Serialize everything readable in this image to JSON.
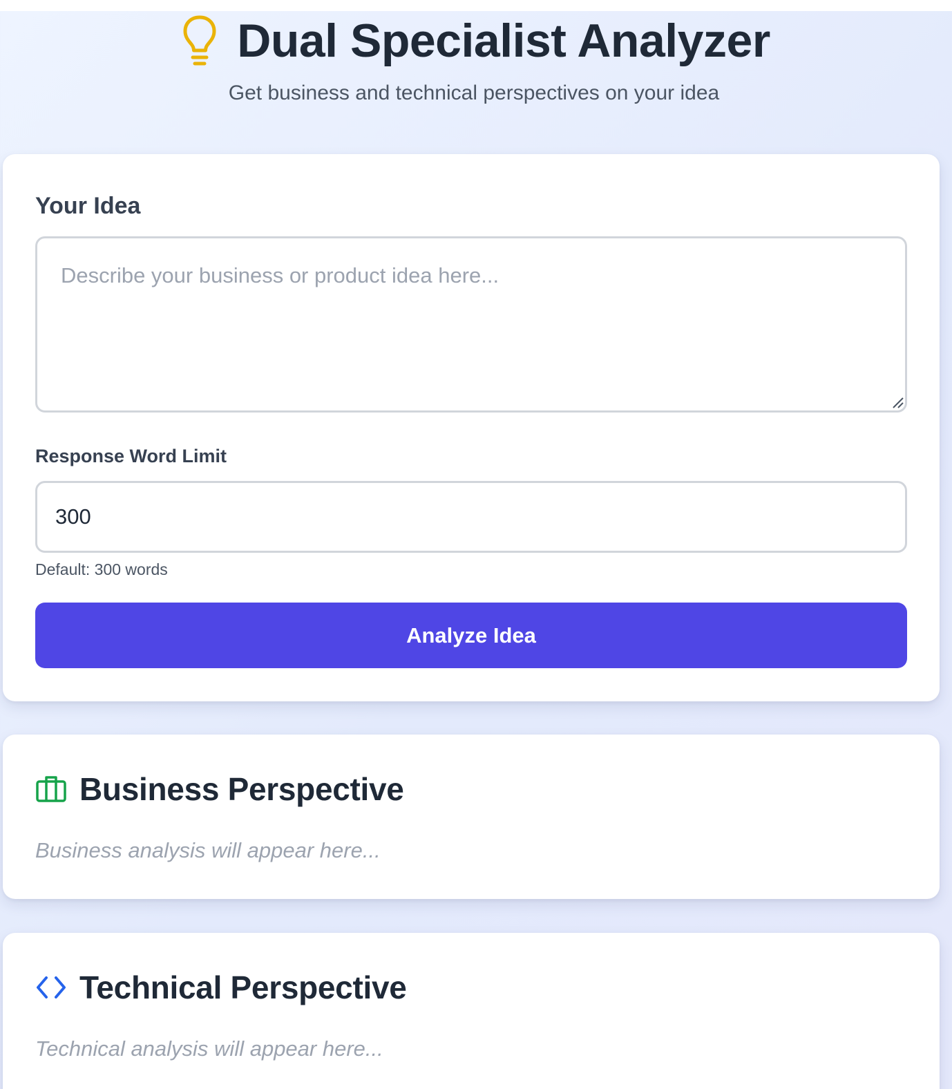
{
  "header": {
    "title": "Dual Specialist Analyzer",
    "subtitle": "Get business and technical perspectives on your idea",
    "icon": "lightbulb-icon",
    "icon_color": "#eab308"
  },
  "form": {
    "idea_label": "Your Idea",
    "idea_placeholder": "Describe your business or product idea here...",
    "idea_value": "",
    "limit_label": "Response Word Limit",
    "limit_value": "300",
    "limit_hint": "Default: 300 words",
    "analyze_button": "Analyze Idea",
    "button_color": "#4f46e5"
  },
  "business": {
    "title": "Business Perspective",
    "placeholder": "Business analysis will appear here...",
    "icon": "briefcase-icon",
    "icon_color": "#16a34a"
  },
  "technical": {
    "title": "Technical Perspective",
    "placeholder": "Technical analysis will appear here...",
    "icon": "code-icon",
    "icon_color": "#2563eb"
  }
}
